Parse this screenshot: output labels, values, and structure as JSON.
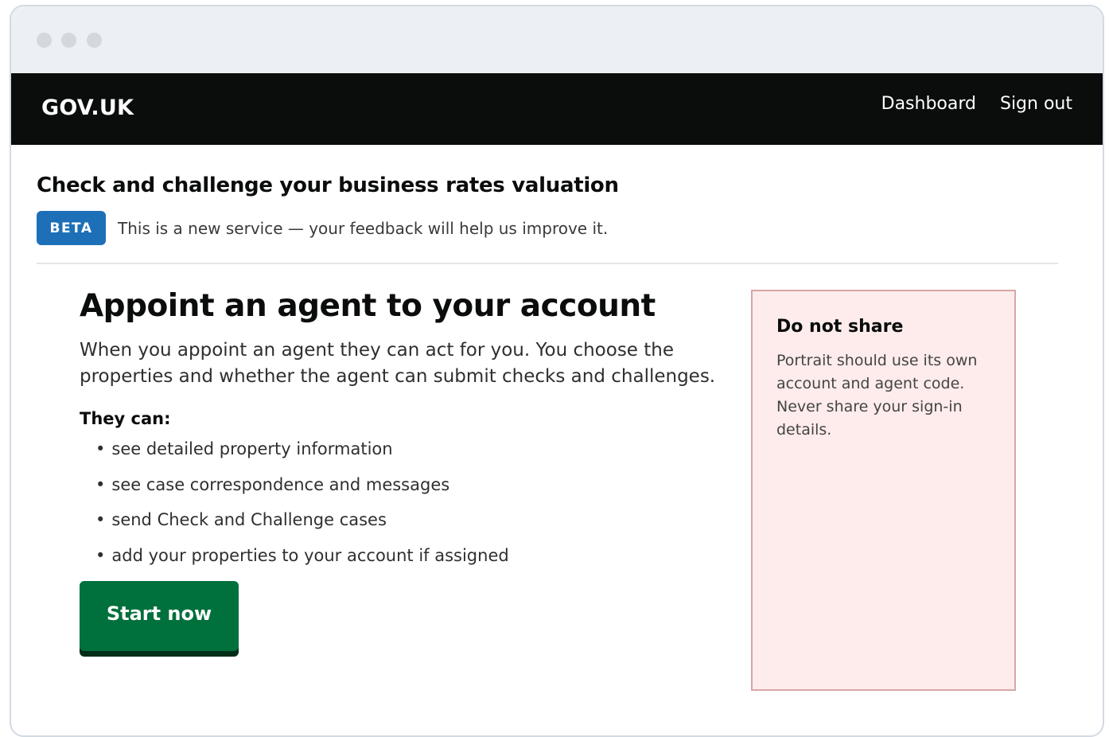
{
  "window": {
    "controls": [
      "close",
      "minimize",
      "maximize"
    ]
  },
  "topnav": {
    "brand": "GOV.UK",
    "links": [
      "Dashboard",
      "Sign out"
    ]
  },
  "service": {
    "title": "Check and challenge your business rates valuation",
    "phase_tag": "BETA",
    "phase_text": "This is a new service — your feedback will help us improve it."
  },
  "main": {
    "heading": "Appoint an agent to your account",
    "lead": "When you appoint an agent they can act for you. You choose the properties and whether the agent can submit checks and challenges.",
    "subheading": "They can:",
    "list": [
      "see detailed property information",
      "see case correspondence and messages",
      "send Check and Challenge cases",
      "add your properties to your account if assigned"
    ],
    "start_button": "Start now"
  },
  "aside": {
    "title": "Do not share",
    "body": "Portrait should use its own account and agent code. Never share your sign-in details."
  },
  "colors": {
    "nav_bg": "#0b0c0c",
    "beta_tag": "#1d70b8",
    "start_button": "#00703c",
    "aside_bg": "#fdeceb",
    "aside_border": "#d9a6a6"
  }
}
